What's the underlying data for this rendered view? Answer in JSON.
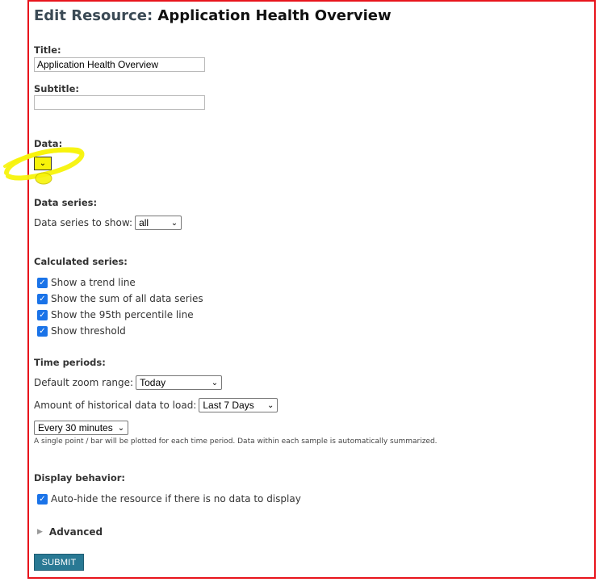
{
  "header": {
    "prefix": "Edit Resource:",
    "resource_name": "Application Health Overview"
  },
  "form": {
    "title_label": "Title:",
    "title_value": "Application Health Overview",
    "subtitle_label": "Subtitle:",
    "subtitle_value": "",
    "data_label": "Data:"
  },
  "data_series": {
    "section_title": "Data series:",
    "show_label": "Data series to show:",
    "show_value": "all"
  },
  "calculated_series": {
    "section_title": "Calculated series:",
    "items": [
      {
        "label": "Show a trend line",
        "checked": true
      },
      {
        "label": "Show the sum of all data series",
        "checked": true
      },
      {
        "label": "Show the 95th percentile line",
        "checked": true
      },
      {
        "label": "Show threshold",
        "checked": true
      }
    ]
  },
  "time_periods": {
    "section_title": "Time periods:",
    "zoom_label": "Default zoom range:",
    "zoom_value": "Today",
    "history_label": "Amount of historical data to load:",
    "history_value": "Last 7 Days",
    "interval_value": "Every 30 minutes",
    "helper_text": "A single point / bar will be plotted for each time period. Data within each sample is automatically summarized."
  },
  "display_behavior": {
    "section_title": "Display behavior:",
    "autohide_label": "Auto-hide the resource if there is no data to display",
    "autohide_checked": true
  },
  "advanced": {
    "label": "Advanced"
  },
  "submit_label": "SUBMIT",
  "icons": {
    "chevron": "chevron-down-icon",
    "check": "check-icon",
    "expand": "triangle-right-icon"
  },
  "colors": {
    "checkbox": "#1a73e8",
    "submit": "#297994",
    "frame": "#e8141c",
    "highlight": "#f7f30a"
  }
}
